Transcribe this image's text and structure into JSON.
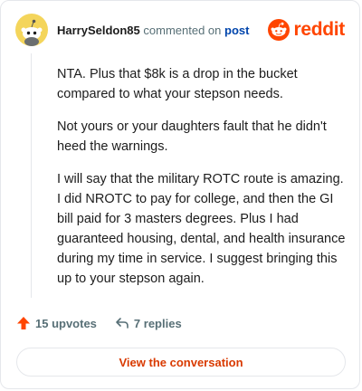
{
  "header": {
    "username": "HarrySeldon85",
    "action_text": "commented on",
    "post_link": "post",
    "brand_word": "reddit",
    "brand_color": "#ff4500"
  },
  "comment": {
    "paragraphs": [
      "NTA. Plus that $8k is a drop in the bucket compared to what your stepson needs.",
      "Not yours or your daughters fault that he didn't heed the warnings.",
      "I will say that the military ROTC route is amazing. I did NROTC to pay for college, and then the GI bill paid for 3 masters degrees. Plus I had guaranteed housing, dental, and health insurance during my time in service. I suggest bringing this up to your stepson again."
    ]
  },
  "actions": {
    "upvotes": "15 upvotes",
    "replies": "7 replies",
    "upvote_icon": "upvote-arrow-icon",
    "reply_icon": "reply-arrow-icon",
    "upvote_color": "#ff4500"
  },
  "cta": {
    "label": "View the conversation",
    "color": "#d93a00"
  },
  "avatar": {
    "icon": "snoo-avatar-icon",
    "background": "#f4d55b"
  }
}
